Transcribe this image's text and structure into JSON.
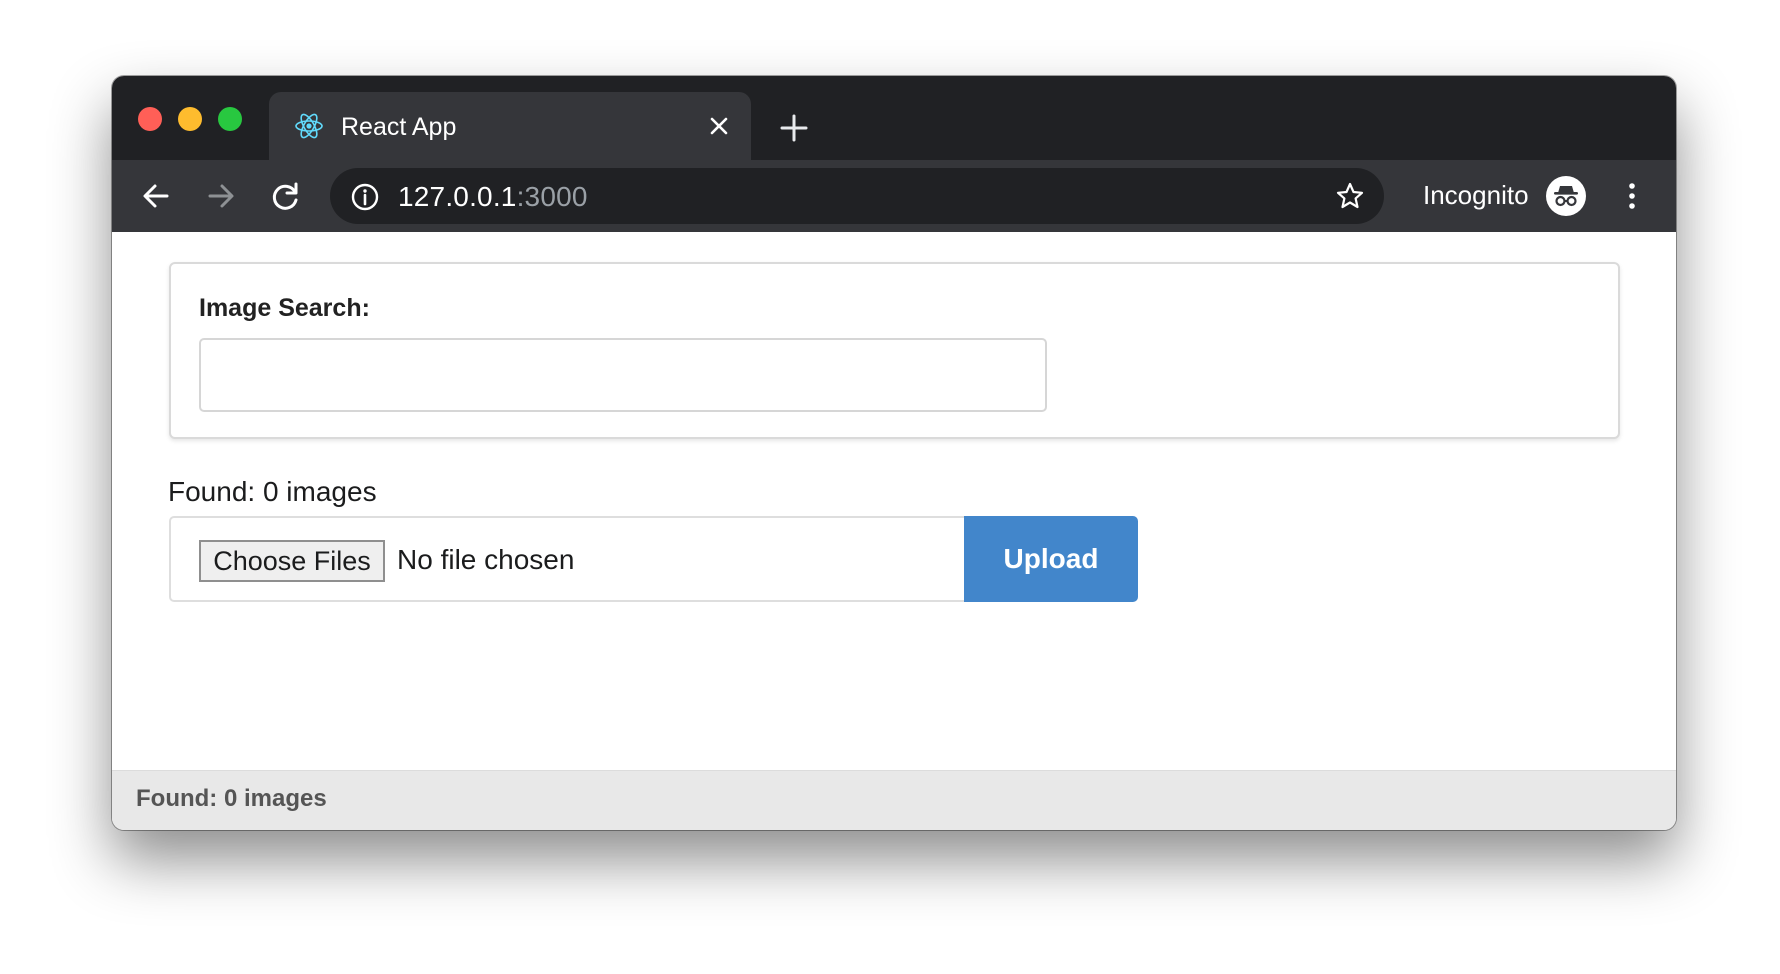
{
  "window": {
    "controls": {
      "close_color": "#ff5f57",
      "minimize_color": "#febc2e",
      "zoom_color": "#28c840"
    }
  },
  "tab": {
    "title": "React App",
    "favicon": "react-logo-icon",
    "close_icon": "close-icon"
  },
  "toolbar": {
    "url_host": "127.0.0.1",
    "url_port": ":3000",
    "incognito_label": "Incognito",
    "icons": [
      "arrow-left-icon",
      "arrow-right-icon",
      "reload-icon",
      "info-icon",
      "star-icon",
      "incognito-icon",
      "kebab-menu-icon"
    ]
  },
  "search": {
    "label": "Image Search:",
    "value": "",
    "placeholder": ""
  },
  "results": {
    "found_text": "Found: 0 images"
  },
  "upload": {
    "choose_label": "Choose Files",
    "file_status": "No file chosen",
    "upload_label": "Upload",
    "upload_color": "#4286cb"
  },
  "status_bar": {
    "text": "Found: 0 images"
  }
}
